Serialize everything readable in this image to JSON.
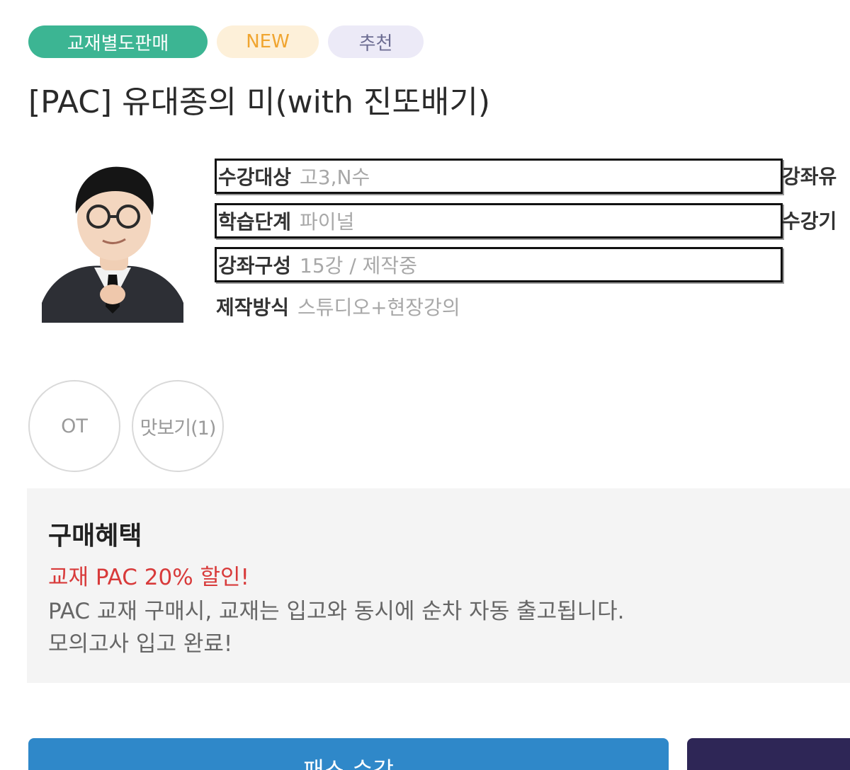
{
  "tags": {
    "separate_sale": "교재별도판매",
    "new": "NEW",
    "recommended": "추천"
  },
  "course": {
    "title": "[PAC] 유대종의 미(with 진또배기)"
  },
  "info": [
    {
      "label": "수강대상",
      "value": "고3,N수"
    },
    {
      "label": "학습단계",
      "value": "파이널"
    },
    {
      "label": "강좌구성",
      "value": "15강 / 제작중"
    },
    {
      "label": "제작방식",
      "value": "스튜디오+현장강의"
    }
  ],
  "side_labels": [
    "강좌유",
    "수강기"
  ],
  "preview": {
    "ot": "OT",
    "taste": "맛보기(1)"
  },
  "benefit": {
    "title": "구매혜택",
    "highlight": "교재 PAC 20% 할인!",
    "line1": "PAC 교재 구매시, 교재는 입고와 동시에 순차 자동 출고됩니다.",
    "line2": "모의고사 입고 완료!"
  },
  "buttons": {
    "pass": "패스 수강"
  },
  "colors": {
    "tag_green": "#3cb593",
    "tag_new_text": "#f0a530",
    "highlight_red": "#d83a3a",
    "pass_button": "#2f88c9",
    "dark_button": "#2e2656"
  }
}
